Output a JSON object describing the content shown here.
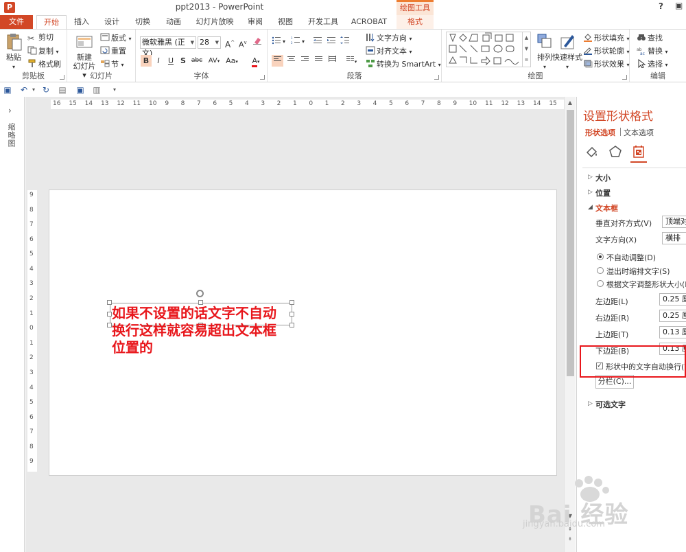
{
  "titlebar": {
    "title": "ppt2013 - PowerPoint",
    "context_tab_group": "绘图工具",
    "help": "?",
    "logo": "P"
  },
  "tabs": [
    "文件",
    "开始",
    "插入",
    "设计",
    "切换",
    "动画",
    "幻灯片放映",
    "审阅",
    "视图",
    "开发工具",
    "ACROBAT",
    "格式"
  ],
  "ribbon": {
    "clipboard": {
      "label": "剪贴板",
      "paste": "粘贴",
      "cut": "剪切",
      "copy": "复制",
      "format_painter": "格式刷"
    },
    "slides": {
      "label": "幻灯片",
      "new_slide": "新建\n幻灯片",
      "layout": "版式",
      "reset": "重置",
      "section": "节"
    },
    "font": {
      "label": "字体",
      "font_name": "微软雅黑 (正文)",
      "font_size": "28",
      "bold": "B",
      "italic": "I",
      "underline": "U",
      "shadow": "S",
      "strike": "abc",
      "spacing": "AV",
      "case": "Aa",
      "color": "A",
      "grow": "A",
      "shrink": "A"
    },
    "paragraph": {
      "label": "段落",
      "text_direction": "文字方向",
      "align_text": "对齐文本",
      "smartart": "转换为 SmartArt"
    },
    "drawing": {
      "label": "绘图",
      "arrange": "排列",
      "quick_styles": "快速样式",
      "shape_fill": "形状填充",
      "shape_outline": "形状轮廓",
      "shape_effects": "形状效果"
    },
    "editing": {
      "label": "编辑",
      "find": "查找",
      "replace": "替换",
      "select": "选择"
    }
  },
  "thumbnail_pane": {
    "label": "缩略图"
  },
  "ruler": {
    "horizontal": [
      "16",
      "15",
      "14",
      "13",
      "12",
      "11",
      "10",
      "9",
      "8",
      "7",
      "6",
      "5",
      "4",
      "3",
      "2",
      "1",
      "0",
      "1",
      "2",
      "3",
      "4",
      "5",
      "6",
      "7",
      "8",
      "9",
      "10",
      "11",
      "12",
      "13",
      "14",
      "15",
      "16"
    ],
    "vertical": [
      "9",
      "8",
      "7",
      "6",
      "5",
      "4",
      "3",
      "2",
      "1",
      "0",
      "1",
      "2",
      "3",
      "4",
      "5",
      "6",
      "7",
      "8",
      "9"
    ]
  },
  "slide": {
    "text": "如果不设置的话文字不自动换行这样就容易超出文本框位置的"
  },
  "format_pane": {
    "title": "设置形状格式",
    "tab_shape": "形状选项",
    "tab_text": "文本选项",
    "sections": {
      "size": "大小",
      "position": "位置",
      "textbox": "文本框",
      "alt_text": "可选文字"
    },
    "vertical_align_label": "垂直对齐方式(V)",
    "vertical_align_value": "顶端对",
    "text_direction_label": "文字方向(X)",
    "text_direction_value": "横排",
    "autofit_none": "不自动调整(D)",
    "autofit_shrink": "溢出时缩排文字(S)",
    "autofit_resize": "根据文字调整形状大小(F)",
    "margin_left_label": "左边距(L)",
    "margin_left_value": "0.25 厘",
    "margin_right_label": "右边距(R)",
    "margin_right_value": "0.25 厘",
    "margin_top_label": "上边距(T)",
    "margin_top_value": "0.13 厘",
    "margin_bottom_label": "下边距(B)",
    "margin_bottom_value": "0.13 厘",
    "wrap_text": "形状中的文字自动换行(W)",
    "columns": "分栏(C)..."
  },
  "watermark": {
    "text": "jingyan.baidu.com",
    "brand": "Bai 经验"
  },
  "colors": {
    "accent": "#d24726",
    "highlight": "#e8161b",
    "slide_text": "#e8161b"
  }
}
